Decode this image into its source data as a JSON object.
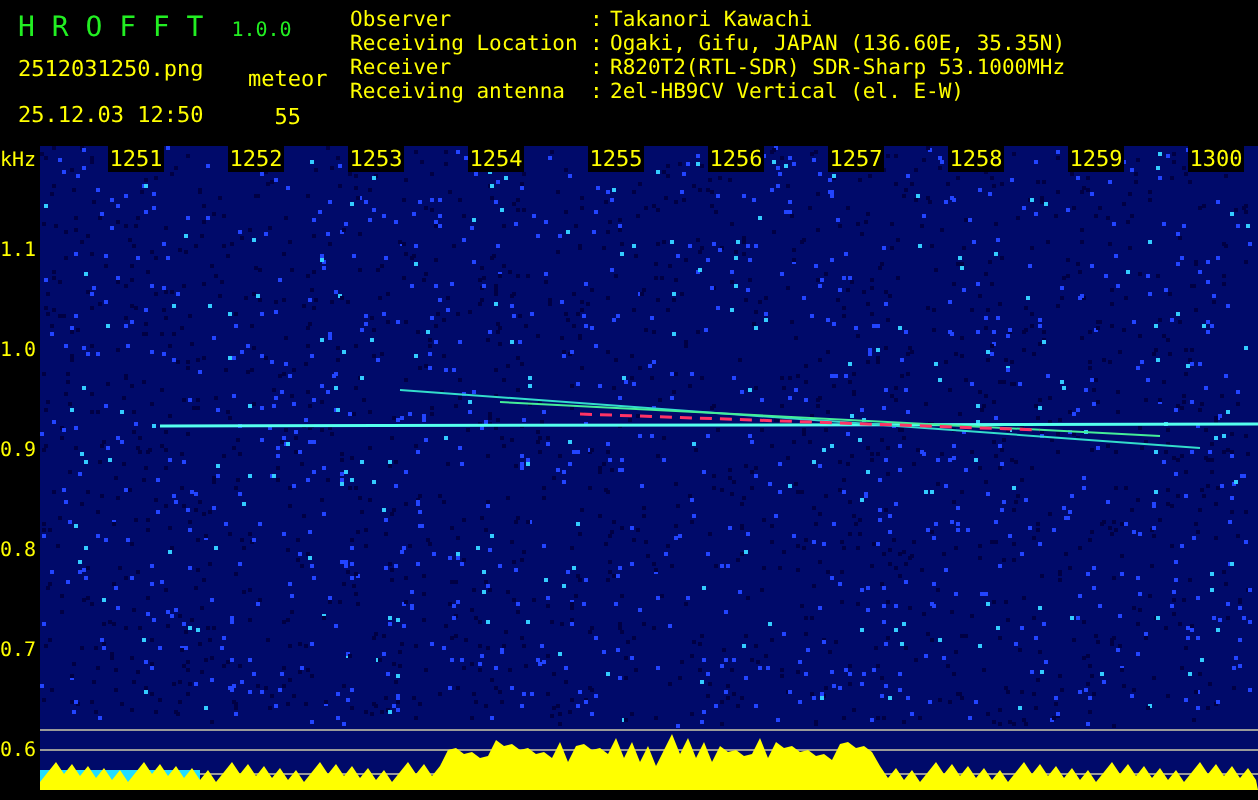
{
  "app": {
    "name": "H R O F F T",
    "version": "1.0.0"
  },
  "file": {
    "name": "2512031250.png",
    "datetime": "25.12.03 12:50"
  },
  "count": {
    "label": "meteor",
    "value": "55"
  },
  "info": [
    {
      "label": "Observer",
      "separator": ":",
      "value": "Takanori Kawachi"
    },
    {
      "label": "Receiving Location",
      "separator": ":",
      "value": "Ogaki, Gifu, JAPAN (136.60E, 35.35N)"
    },
    {
      "label": "Receiver",
      "separator": ":",
      "value": "R820T2(RTL-SDR) SDR-Sharp 53.1000MHz"
    },
    {
      "label": "Receiving antenna",
      "separator": ":",
      "value": "2el-HB9CV Vertical (el. E-W)"
    }
  ],
  "plot": {
    "y_unit": "kHz",
    "y_labels": [
      "1.1",
      "1.0",
      "0.9",
      "0.8",
      "0.7",
      "0.6"
    ],
    "time_labels": [
      "1251",
      "1252",
      "1253",
      "1254",
      "1255",
      "1256",
      "1257",
      "1258",
      "1259",
      "1300"
    ]
  }
}
